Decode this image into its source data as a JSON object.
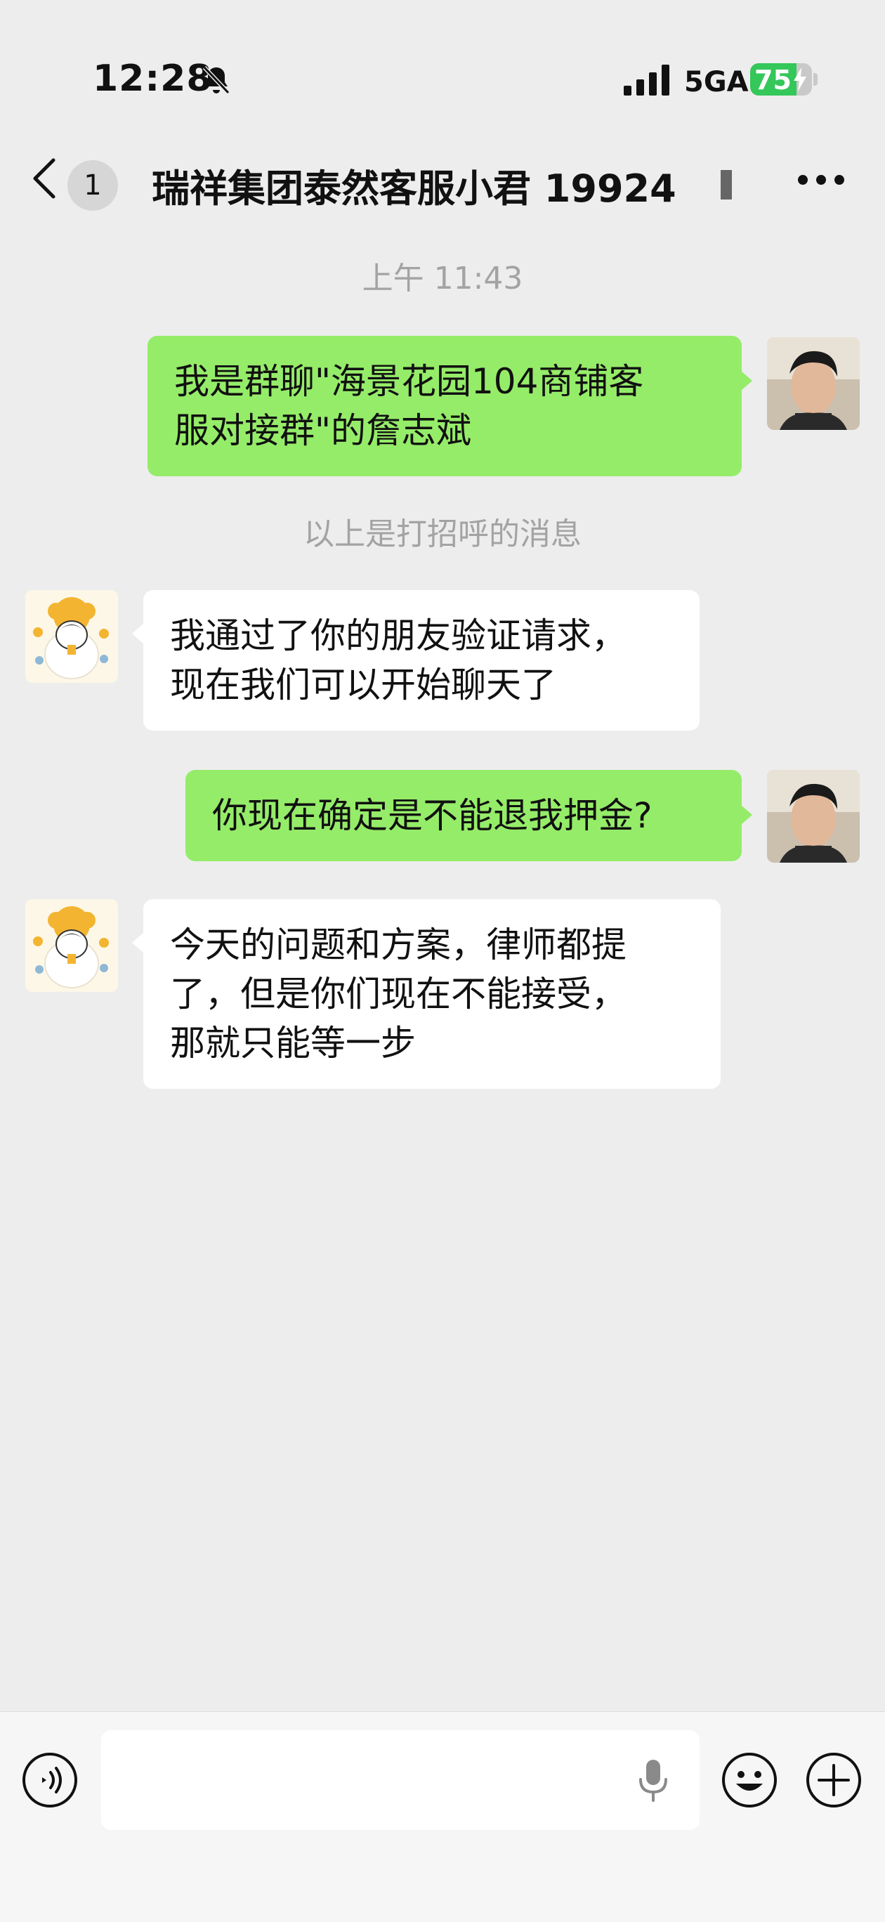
{
  "status_bar": {
    "time": "12:28",
    "network": "5GA",
    "battery_level": "75",
    "battery_fraction": 0.75,
    "icons": [
      "bell-muted-icon",
      "signal-icon",
      "battery-icon",
      "charging-bolt-icon"
    ]
  },
  "nav": {
    "unread_count": "1",
    "title": "瑞祥集团泰然客服小君 19924",
    "icons": [
      "back-chevron-icon",
      "more-dots-icon"
    ]
  },
  "chat": {
    "timestamp": "上午 11:43",
    "system_note": "以上是打招呼的消息",
    "messages": [
      {
        "sender": "me",
        "text": "我是群聊\"海景花园104商铺客\n服对接群\"的詹志斌"
      },
      {
        "sender": "them",
        "text": "我通过了你的朋友验证请求，\n现在我们可以开始聊天了"
      },
      {
        "sender": "me",
        "text": "你现在确定是不能退我押金?"
      },
      {
        "sender": "them",
        "text": "今天的问题和方案，律师都提\n了，但是你们现在不能接受，\n那就只能等一步"
      }
    ]
  },
  "input_bar": {
    "placeholder": "",
    "icons": [
      "voice-icon",
      "microphone-icon",
      "emoji-icon",
      "plus-icon"
    ]
  },
  "colors": {
    "background": "#ededed",
    "my_bubble": "#95ec69",
    "their_bubble": "#ffffff",
    "battery_green": "#34c759",
    "muted_text": "#a3a3a3"
  }
}
